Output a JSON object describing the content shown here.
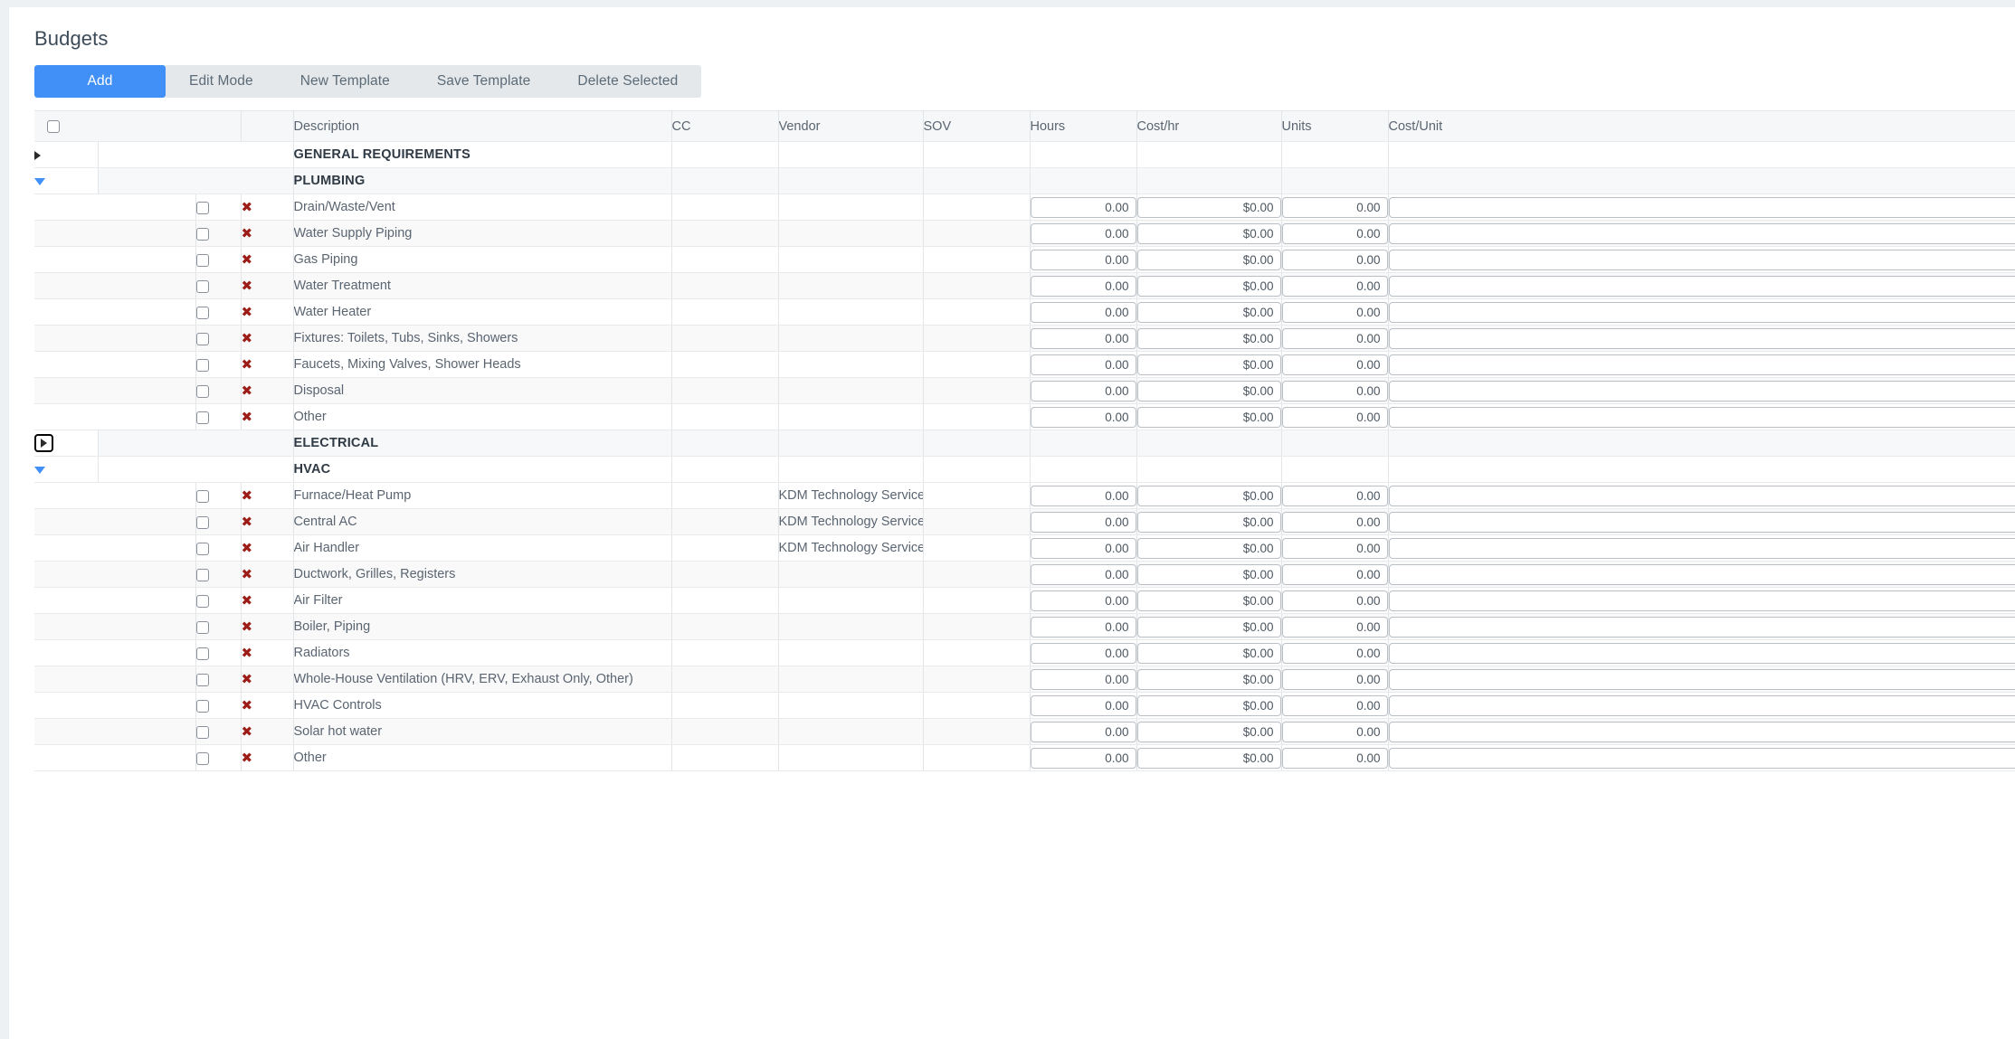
{
  "page": {
    "title": "Budgets"
  },
  "toolbar": {
    "buttons": [
      {
        "label": "Add",
        "primary": true
      },
      {
        "label": "Edit Mode",
        "primary": false
      },
      {
        "label": "New Template",
        "primary": false
      },
      {
        "label": "Save Template",
        "primary": false
      },
      {
        "label": "Delete Selected",
        "primary": false
      }
    ]
  },
  "table": {
    "columns": [
      {
        "key": "expand",
        "label": ""
      },
      {
        "key": "group",
        "label": ""
      },
      {
        "key": "select",
        "label": ""
      },
      {
        "key": "delete",
        "label": ""
      },
      {
        "key": "description",
        "label": "Description"
      },
      {
        "key": "cc",
        "label": "CC"
      },
      {
        "key": "vendor",
        "label": "Vendor"
      },
      {
        "key": "sov",
        "label": "SOV"
      },
      {
        "key": "hours",
        "label": "Hours"
      },
      {
        "key": "cost_hr",
        "label": "Cost/hr"
      },
      {
        "key": "units",
        "label": "Units"
      },
      {
        "key": "cost_unit",
        "label": "Cost/Unit"
      }
    ],
    "select_all_checked": false,
    "defaults": {
      "hours": "0.00",
      "cost_hr": "$0.00",
      "units": "0.00",
      "cost_unit": ""
    },
    "sections": [
      {
        "name": "GENERAL REQUIREMENTS",
        "expanded": false,
        "focused": false,
        "shaded": false,
        "rows": []
      },
      {
        "name": "PLUMBING",
        "expanded": true,
        "focused": false,
        "shaded": true,
        "rows": [
          {
            "description": "Drain/Waste/Vent",
            "cc": "",
            "vendor": "",
            "sov": "",
            "hours": "0.00",
            "cost_hr": "$0.00",
            "units": "0.00",
            "cost_unit": ""
          },
          {
            "description": "Water Supply Piping",
            "cc": "",
            "vendor": "",
            "sov": "",
            "hours": "0.00",
            "cost_hr": "$0.00",
            "units": "0.00",
            "cost_unit": ""
          },
          {
            "description": "Gas Piping",
            "cc": "",
            "vendor": "",
            "sov": "",
            "hours": "0.00",
            "cost_hr": "$0.00",
            "units": "0.00",
            "cost_unit": ""
          },
          {
            "description": "Water Treatment",
            "cc": "",
            "vendor": "",
            "sov": "",
            "hours": "0.00",
            "cost_hr": "$0.00",
            "units": "0.00",
            "cost_unit": ""
          },
          {
            "description": "Water Heater",
            "cc": "",
            "vendor": "",
            "sov": "",
            "hours": "0.00",
            "cost_hr": "$0.00",
            "units": "0.00",
            "cost_unit": ""
          },
          {
            "description": "Fixtures: Toilets, Tubs, Sinks, Showers",
            "cc": "",
            "vendor": "",
            "sov": "",
            "hours": "0.00",
            "cost_hr": "$0.00",
            "units": "0.00",
            "cost_unit": ""
          },
          {
            "description": "Faucets, Mixing Valves, Shower Heads",
            "cc": "",
            "vendor": "",
            "sov": "",
            "hours": "0.00",
            "cost_hr": "$0.00",
            "units": "0.00",
            "cost_unit": ""
          },
          {
            "description": "Disposal",
            "cc": "",
            "vendor": "",
            "sov": "",
            "hours": "0.00",
            "cost_hr": "$0.00",
            "units": "0.00",
            "cost_unit": ""
          },
          {
            "description": "Other",
            "cc": "",
            "vendor": "",
            "sov": "",
            "hours": "0.00",
            "cost_hr": "$0.00",
            "units": "0.00",
            "cost_unit": ""
          }
        ]
      },
      {
        "name": "ELECTRICAL",
        "expanded": false,
        "focused": true,
        "shaded": true,
        "rows": []
      },
      {
        "name": "HVAC",
        "expanded": true,
        "shaded": false,
        "focused": false,
        "rows": [
          {
            "description": "Furnace/Heat Pump",
            "cc": "",
            "vendor": "KDM Technology Services",
            "sov": "",
            "hours": "0.00",
            "cost_hr": "$0.00",
            "units": "0.00",
            "cost_unit": ""
          },
          {
            "description": "Central AC",
            "cc": "",
            "vendor": "KDM Technology Services",
            "sov": "",
            "hours": "0.00",
            "cost_hr": "$0.00",
            "units": "0.00",
            "cost_unit": ""
          },
          {
            "description": "Air Handler",
            "cc": "",
            "vendor": "KDM Technology Services",
            "sov": "",
            "hours": "0.00",
            "cost_hr": "$0.00",
            "units": "0.00",
            "cost_unit": ""
          },
          {
            "description": "Ductwork, Grilles, Registers",
            "cc": "",
            "vendor": "",
            "sov": "",
            "hours": "0.00",
            "cost_hr": "$0.00",
            "units": "0.00",
            "cost_unit": ""
          },
          {
            "description": "Air Filter",
            "cc": "",
            "vendor": "",
            "sov": "",
            "hours": "0.00",
            "cost_hr": "$0.00",
            "units": "0.00",
            "cost_unit": ""
          },
          {
            "description": "Boiler, Piping",
            "cc": "",
            "vendor": "",
            "sov": "",
            "hours": "0.00",
            "cost_hr": "$0.00",
            "units": "0.00",
            "cost_unit": ""
          },
          {
            "description": "Radiators",
            "cc": "",
            "vendor": "",
            "sov": "",
            "hours": "0.00",
            "cost_hr": "$0.00",
            "units": "0.00",
            "cost_unit": ""
          },
          {
            "description": "Whole-House Ventilation (HRV, ERV, Exhaust Only, Other)",
            "cc": "",
            "vendor": "",
            "sov": "",
            "hours": "0.00",
            "cost_hr": "$0.00",
            "units": "0.00",
            "cost_unit": ""
          },
          {
            "description": "HVAC Controls",
            "cc": "",
            "vendor": "",
            "sov": "",
            "hours": "0.00",
            "cost_hr": "$0.00",
            "units": "0.00",
            "cost_unit": ""
          },
          {
            "description": "Solar hot water",
            "cc": "",
            "vendor": "",
            "sov": "",
            "hours": "0.00",
            "cost_hr": "$0.00",
            "units": "0.00",
            "cost_unit": ""
          },
          {
            "description": "Other",
            "cc": "",
            "vendor": "",
            "sov": "",
            "hours": "0.00",
            "cost_hr": "$0.00",
            "units": "0.00",
            "cost_unit": ""
          }
        ]
      }
    ]
  },
  "icons": {
    "expand_collapsed": "triangle-right-icon",
    "expand_expanded": "triangle-down-icon",
    "delete_row": "delete-x-icon",
    "select_row": "row-checkbox"
  },
  "colors": {
    "primary": "#4190f7",
    "toolbar_bg": "#e4e8ea",
    "delete_x": "#9c1c17",
    "header_bg": "#f6f7f8",
    "row_alt_bg": "#f9f9fa"
  }
}
